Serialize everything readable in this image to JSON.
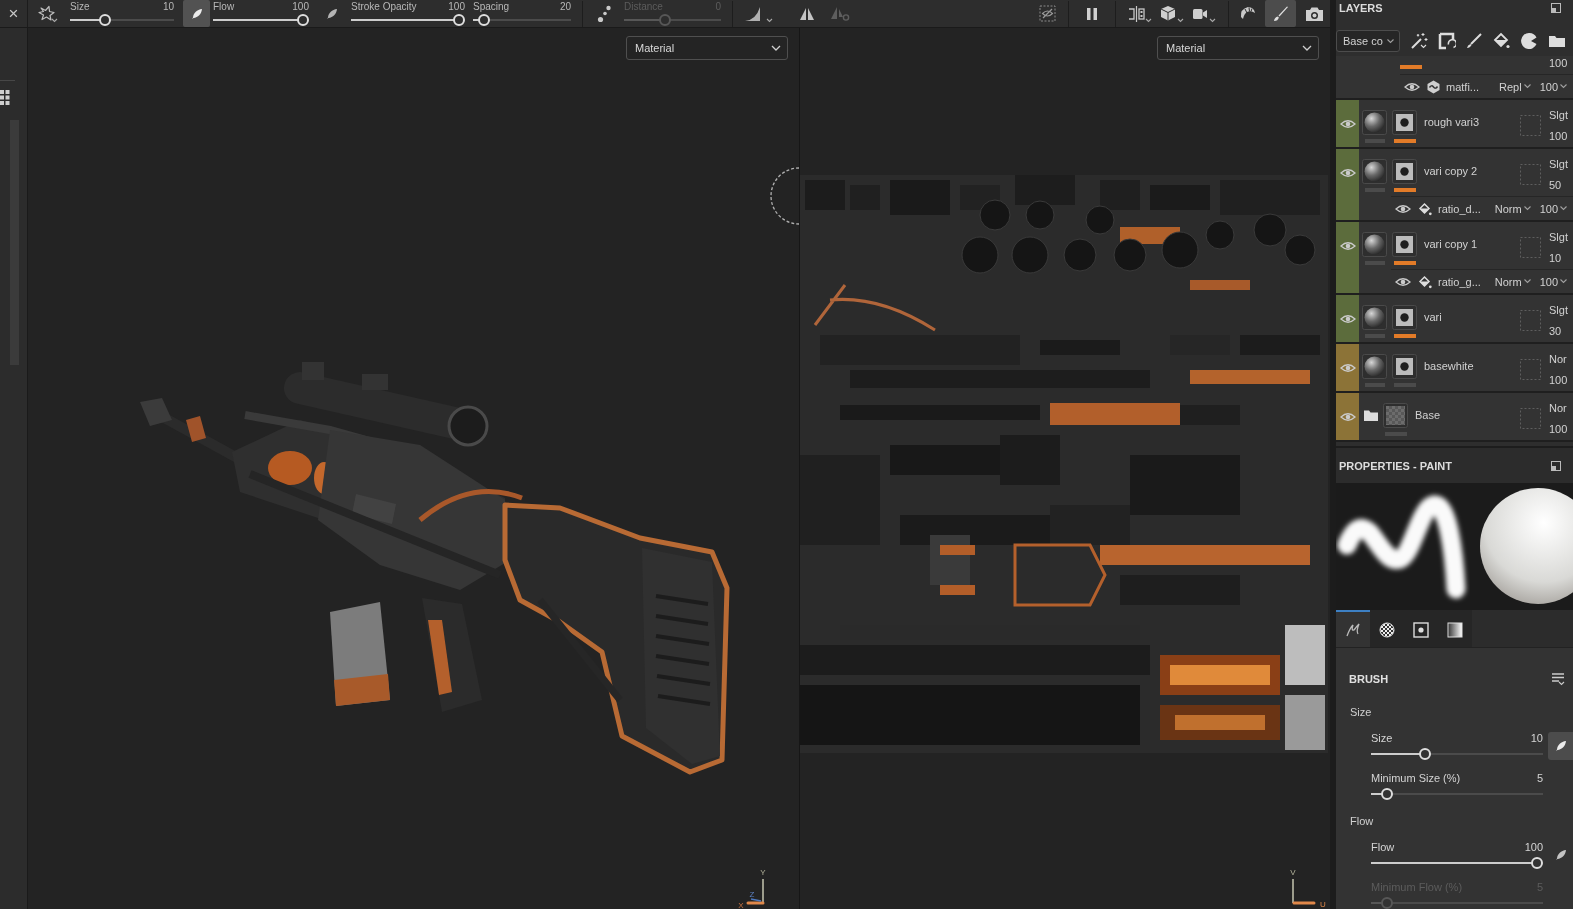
{
  "toolbar": {
    "close": "×",
    "brush_sliders": [
      {
        "label": "Size",
        "value": "10",
        "level": 0.31,
        "pressure": true
      },
      {
        "label": "Flow",
        "value": "100",
        "level": 1,
        "pressure": false
      },
      {
        "label": "Stroke Opacity",
        "value": "100",
        "level": 1
      },
      {
        "label": "Spacing",
        "value": "20",
        "level": 0.06
      }
    ],
    "lazy_mouse": {
      "label": "Distance",
      "value": "0",
      "level": 0.41,
      "disabled": true
    },
    "symmetry_tools": [
      {
        "disabled": false
      },
      {
        "disabled": true
      }
    ],
    "modes": [
      {
        "selected": false
      },
      {
        "selected": true
      },
      {
        "selected": false
      }
    ]
  },
  "viewports": [
    {
      "kind": "model",
      "mode": "Material",
      "axes": [
        "Y",
        "Z",
        "X"
      ]
    },
    {
      "kind": "uv",
      "mode": "Material",
      "axes": [
        "V",
        "U"
      ]
    }
  ],
  "layers": {
    "title": "LAYERS",
    "channel": "Base co",
    "rows": [
      {
        "kind": "cut",
        "opacity": "100",
        "mask_selected": true,
        "children": [
          {
            "kind": "filter",
            "name": "matfi...",
            "blend": "Repl",
            "opacity": "100"
          }
        ]
      },
      {
        "kind": "layer",
        "name": "rough vari3",
        "color": "#5c6c3c",
        "blend": "Slgt",
        "opacity": "100",
        "mask_selected": true
      },
      {
        "kind": "layer",
        "name": "vari copy 2",
        "color": "#5c6c3c",
        "blend": "Slgt",
        "opacity": "50",
        "mask_selected": true,
        "children": [
          {
            "kind": "fill",
            "name": "ratio_d...",
            "blend": "Norm",
            "opacity": "100"
          }
        ]
      },
      {
        "kind": "layer",
        "name": "vari copy 1",
        "color": "#5c6c3c",
        "blend": "Slgt",
        "opacity": "10",
        "mask_selected": true,
        "children": [
          {
            "kind": "fill",
            "name": "ratio_g...",
            "blend": "Norm",
            "opacity": "100"
          }
        ]
      },
      {
        "kind": "layer",
        "name": "vari",
        "color": "#5c6c3c",
        "blend": "Slgt",
        "opacity": "30",
        "mask_selected": true
      },
      {
        "kind": "layer",
        "name": "basewhite",
        "color": "#8c7337",
        "blend": "Nor",
        "opacity": "100",
        "mask_selected": false
      },
      {
        "kind": "folder",
        "name": "Base",
        "color": "#8c7337",
        "blend": "Nor",
        "opacity": "100",
        "mask_selected": false
      }
    ]
  },
  "properties": {
    "title": "PROPERTIES - PAINT",
    "tabs": [
      {
        "selected": true
      },
      {
        "selected": false
      },
      {
        "selected": false
      },
      {
        "selected": false
      }
    ],
    "section": "BRUSH",
    "groups": [
      {
        "title": "Size",
        "params": [
          {
            "label": "Size",
            "value": "10",
            "level": 0.3,
            "disabled": false,
            "pressure": true
          },
          {
            "label": "Minimum Size (%)",
            "value": "5",
            "level": 0.06,
            "disabled": false
          }
        ]
      },
      {
        "title": "Flow",
        "params": [
          {
            "label": "Flow",
            "value": "100",
            "level": 1,
            "disabled": false,
            "pressure": false
          },
          {
            "label": "Minimum Flow (%)",
            "value": "5",
            "level": 0.06,
            "disabled": true
          }
        ]
      }
    ]
  }
}
